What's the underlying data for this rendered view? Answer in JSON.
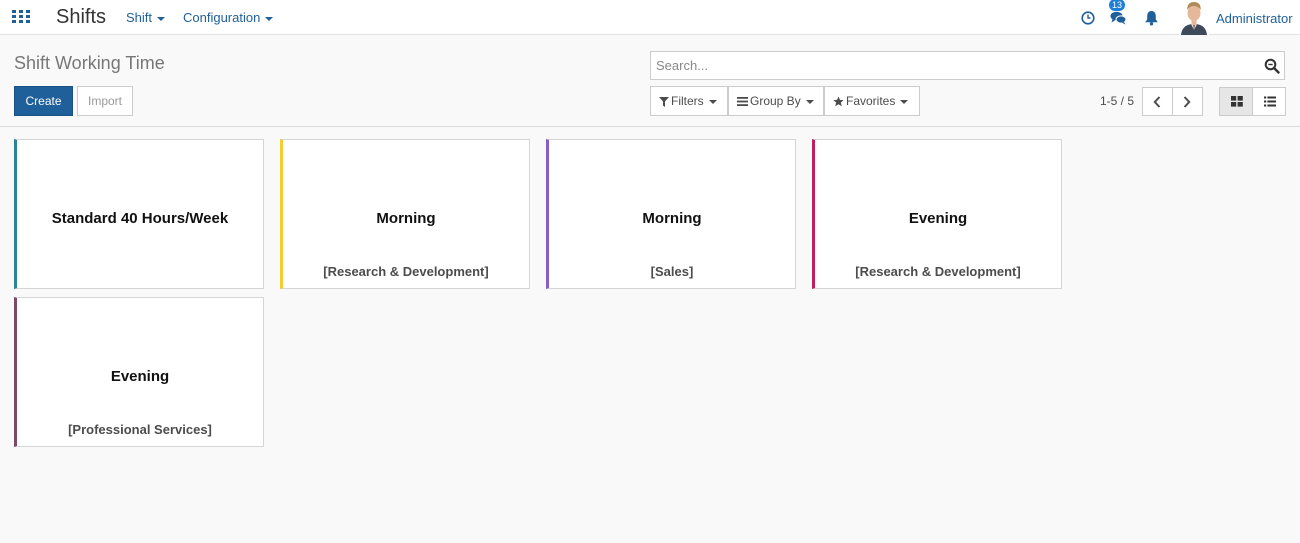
{
  "app": {
    "title": "Shifts",
    "menus": [
      {
        "label": "Shift"
      },
      {
        "label": "Configuration"
      }
    ]
  },
  "systray": {
    "messages_count": "13",
    "user_name": "Administrator"
  },
  "control_panel": {
    "title": "Shift Working Time",
    "create_label": "Create",
    "import_label": "Import",
    "search_placeholder": "Search...",
    "filters_label": "Filters",
    "groupby_label": "Group By",
    "favorites_label": "Favorites",
    "pager": "1-5 / 5"
  },
  "cards": [
    {
      "name": "Standard 40 Hours/Week",
      "department": "",
      "color": "#2c8397"
    },
    {
      "name": "Morning",
      "department": "[Research & Development]",
      "color": "#f4cc33"
    },
    {
      "name": "Morning",
      "department": "[Sales]",
      "color": "#875fc1"
    },
    {
      "name": "Evening",
      "department": "[Research & Development]",
      "color": "#c41e63"
    },
    {
      "name": "Evening",
      "department": "[Professional Services]",
      "color": "#7b4a63"
    }
  ],
  "colors": {
    "primary": "#1f5f9a",
    "badge": "#1f7fd6"
  }
}
